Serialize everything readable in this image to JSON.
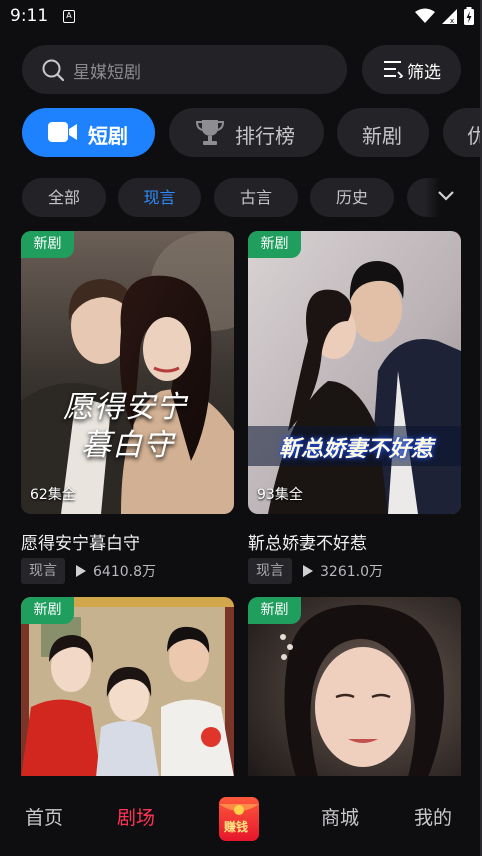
{
  "status": {
    "time": "9:11",
    "sim_letter": "A"
  },
  "search": {
    "placeholder": "星媒短剧",
    "filter_label": "筛选"
  },
  "top_tabs": [
    {
      "label": "短剧",
      "active": true
    },
    {
      "label": "排行榜",
      "active": false
    },
    {
      "label": "新剧",
      "active": false
    },
    {
      "label": "优",
      "active": false
    }
  ],
  "categories": [
    {
      "label": "全部",
      "active": false
    },
    {
      "label": "现言",
      "active": true
    },
    {
      "label": "古言",
      "active": false
    },
    {
      "label": "历史",
      "active": false
    }
  ],
  "cards": [
    {
      "badge": "新剧",
      "episodes": "62集全",
      "title": "愿得安宁暮白守",
      "tag": "现言",
      "plays": "6410.8万",
      "poster_text": "愿得安宁\n暮白守"
    },
    {
      "badge": "新剧",
      "episodes": "93集全",
      "title": "靳总娇妻不好惹",
      "tag": "现言",
      "plays": "3261.0万",
      "poster_text": "靳总娇妻不好惹"
    },
    {
      "badge": "新剧"
    },
    {
      "badge": "新剧"
    }
  ],
  "bottom_nav": [
    {
      "label": "首页",
      "active": false
    },
    {
      "label": "剧场",
      "active": true
    },
    {
      "label": "赚钱",
      "active": false
    },
    {
      "label": "商城",
      "active": false
    },
    {
      "label": "我的",
      "active": false
    }
  ],
  "colors": {
    "accent": "#1e82ff",
    "active_nav": "#ff3355",
    "badge": "#1f9e5e",
    "background": "#0e0e10"
  }
}
